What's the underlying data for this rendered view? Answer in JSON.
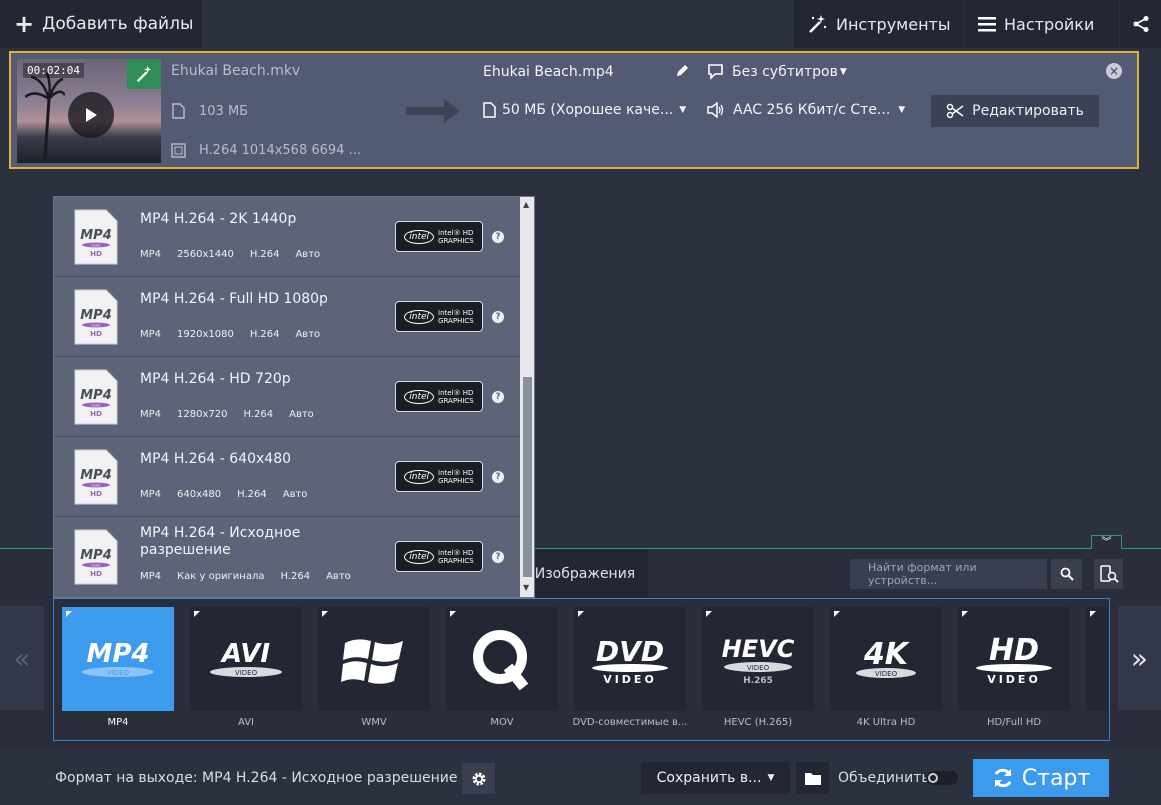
{
  "header": {
    "add_files_label": "Добавить файлы",
    "tools_label": "Инструменты",
    "settings_label": "Настройки"
  },
  "file": {
    "duration": "00:02:04",
    "source_name": "Ehukai Beach.mkv",
    "source_size": "103 МБ",
    "source_codec": "H.264 1014x568 6694 ...",
    "output_name": "Ehukai Beach.mp4",
    "output_size": "50 МБ (Хорошее каче...",
    "subtitles": "Без субтитров",
    "audio": "AAC 256 Кбит/с Сте...",
    "edit_label": "Редактировать"
  },
  "presets": [
    {
      "title": "MP4 H.264 - 2K 1440p",
      "specs": [
        "MP4",
        "2560x1440",
        "H.264",
        "Авто"
      ]
    },
    {
      "title": "MP4 H.264 - Full HD 1080p",
      "specs": [
        "MP4",
        "1920x1080",
        "H.264",
        "Авто"
      ]
    },
    {
      "title": "MP4 H.264 - HD 720p",
      "specs": [
        "MP4",
        "1280x720",
        "H.264",
        "Авто"
      ]
    },
    {
      "title": "MP4 H.264 - 640x480",
      "specs": [
        "MP4",
        "640x480",
        "H.264",
        "Авто"
      ]
    },
    {
      "title": "MP4 H.264 - Исходное разрешение",
      "specs": [
        "MP4",
        "Как у оригинала",
        "H.264",
        "Авто"
      ]
    }
  ],
  "intel_badge": {
    "logo": "intel",
    "line1": "Intel® HD",
    "line2": "GRAPHICS"
  },
  "preset_icon": {
    "big": "MP4",
    "mid": "VIDEO",
    "small": "HD"
  },
  "category": {
    "images_tab": "Изображения"
  },
  "search": {
    "placeholder": "Найти формат или устройств..."
  },
  "formats": [
    {
      "label": "MP4",
      "logo": "MP4",
      "sub": "VIDEO"
    },
    {
      "label": "AVI",
      "logo": "AVI",
      "sub": "VIDEO"
    },
    {
      "label": "WMV",
      "logo": "windows",
      "sub": ""
    },
    {
      "label": "MOV",
      "logo": "quicktime",
      "sub": ""
    },
    {
      "label": "DVD-совместимые в...",
      "logo": "DVD",
      "sub": "VIDEO"
    },
    {
      "label": "HEVC (H.265)",
      "logo": "HEVC",
      "sub": "VIDEO",
      "sub2": "H.265"
    },
    {
      "label": "4K Ultra HD",
      "logo": "4K",
      "sub": "VIDEO"
    },
    {
      "label": "HD/Full HD",
      "logo": "HD",
      "sub": "VIDEO"
    }
  ],
  "nav": {
    "prev": "«",
    "next": "»"
  },
  "footer": {
    "output_format": "Формат на выходе: MP4 H.264 - Исходное разрешение",
    "save_label": "Сохранить в...",
    "merge_label": "Объединить",
    "start_label": "Старт"
  },
  "colors": {
    "accent": "#3d9bee",
    "selection_border": "#e0b13a",
    "panel": "#535a73"
  }
}
